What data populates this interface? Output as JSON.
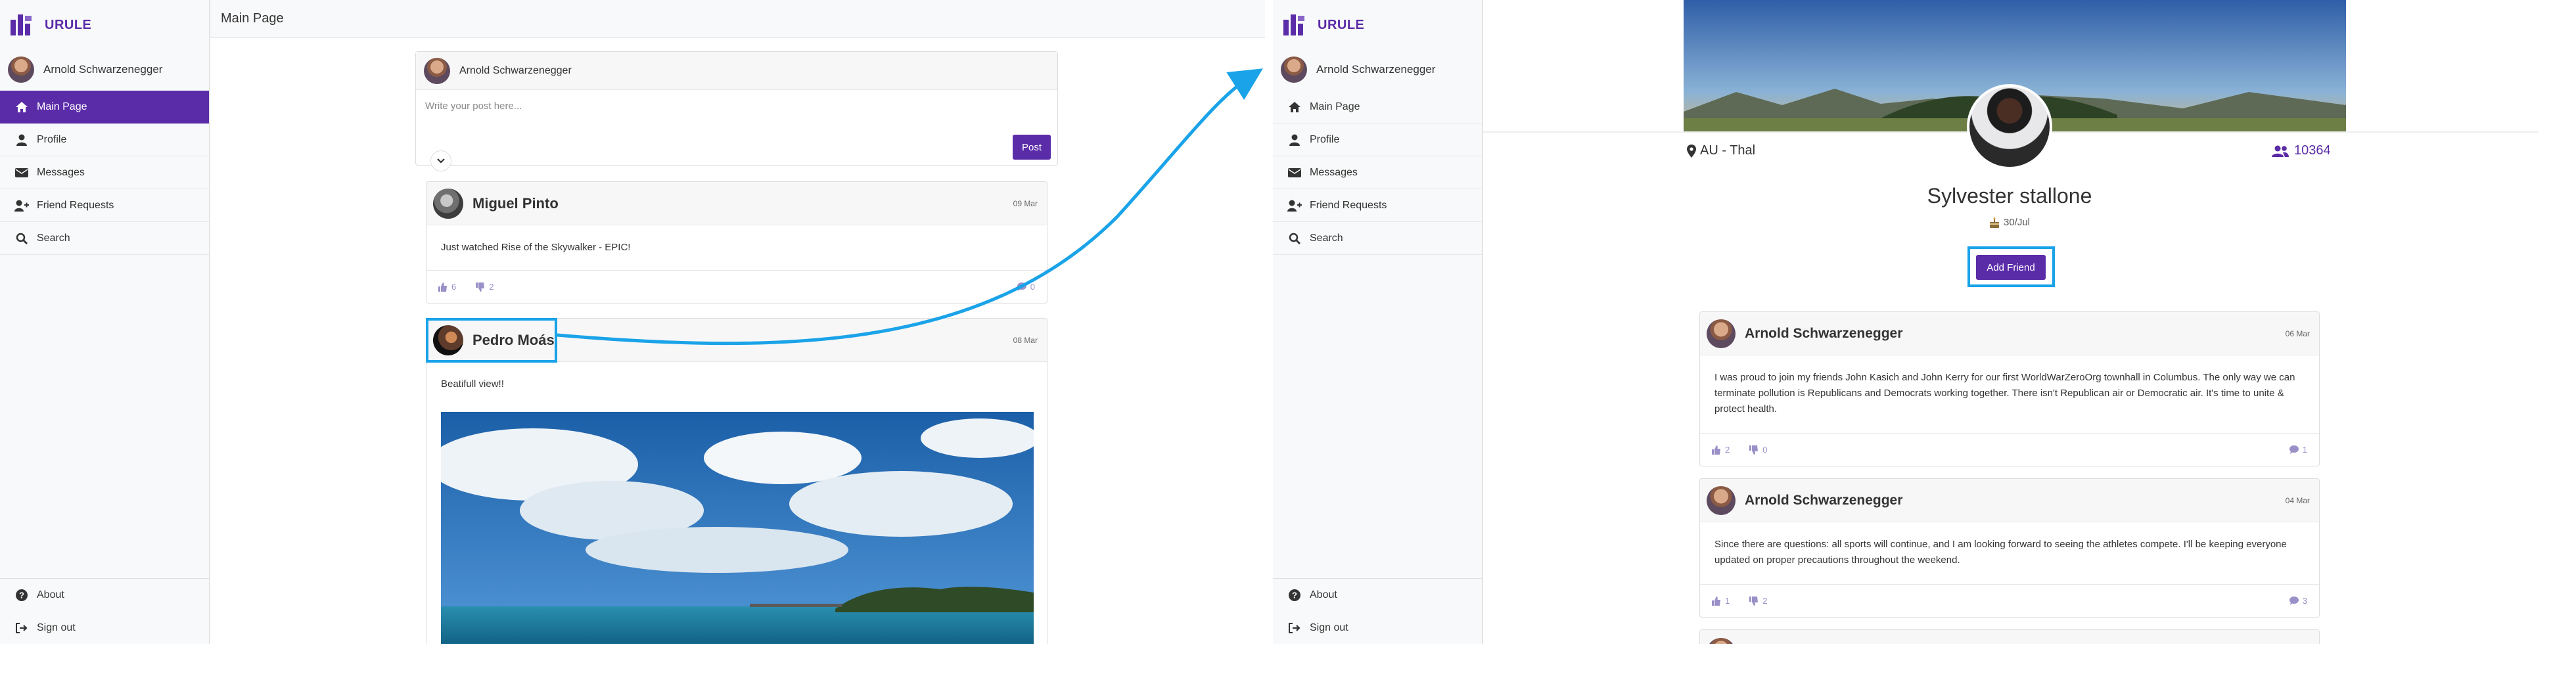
{
  "app": {
    "brand": "URULE"
  },
  "left": {
    "user": "Arnold Schwarzenegger",
    "nav": [
      "Main Page",
      "Profile",
      "Messages",
      "Friend Requests",
      "Search"
    ],
    "nav_bottom": [
      "About",
      "Sign out"
    ],
    "page_title": "Main Page",
    "composer": {
      "name": "Arnold Schwarzenegger",
      "placeholder": "Write your post here...",
      "post_label": "Post"
    },
    "posts": [
      {
        "author": "Miguel Pinto",
        "date": "09 Mar",
        "text": "Just watched Rise of the Skywalker - EPIC!",
        "likes": "6",
        "dislikes": "2",
        "comments": "0"
      },
      {
        "author": "Pedro Moás",
        "date": "08 Mar",
        "text": "Beatifull view!!"
      }
    ]
  },
  "right": {
    "user": "Arnold Schwarzenegger",
    "nav": [
      "Main Page",
      "Profile",
      "Messages",
      "Friend Requests",
      "Search"
    ],
    "nav_bottom": [
      "About",
      "Sign out"
    ],
    "profile": {
      "location": "AU - Thal",
      "friends": "10364",
      "name": "Sylvester stallone",
      "birthday": "30/Jul",
      "add_friend_label": "Add Friend"
    },
    "posts": [
      {
        "author": "Arnold Schwarzenegger",
        "date": "06 Mar",
        "text": "I was proud to join my friends John Kasich and John Kerry for our first WorldWarZeroOrg townhall in Columbus. The only way we can terminate pollution is Republicans and Democrats working together. There isn't Republican air or Democratic air. It's time to unite & protect health.",
        "likes": "2",
        "dislikes": "0",
        "comments": "1"
      },
      {
        "author": "Arnold Schwarzenegger",
        "date": "04 Mar",
        "text": "Since there are questions: all sports will continue, and I am looking forward to seeing the athletes compete. I'll be keeping everyone updated on proper precautions throughout the weekend.",
        "likes": "1",
        "dislikes": "2",
        "comments": "3"
      }
    ]
  },
  "colors": {
    "accent": "#5b2ca8",
    "annotation": "#1aa3e8",
    "icon_muted": "#9a8fc7"
  },
  "icons": [
    "logo-icon",
    "home-icon",
    "user-icon",
    "envelope-icon",
    "user-plus-icon",
    "search-icon",
    "question-icon",
    "sign-out-icon",
    "thumbs-up-icon",
    "thumbs-down-icon",
    "comment-icon",
    "map-pin-icon",
    "users-icon",
    "cake-icon",
    "chevron-down-icon"
  ]
}
